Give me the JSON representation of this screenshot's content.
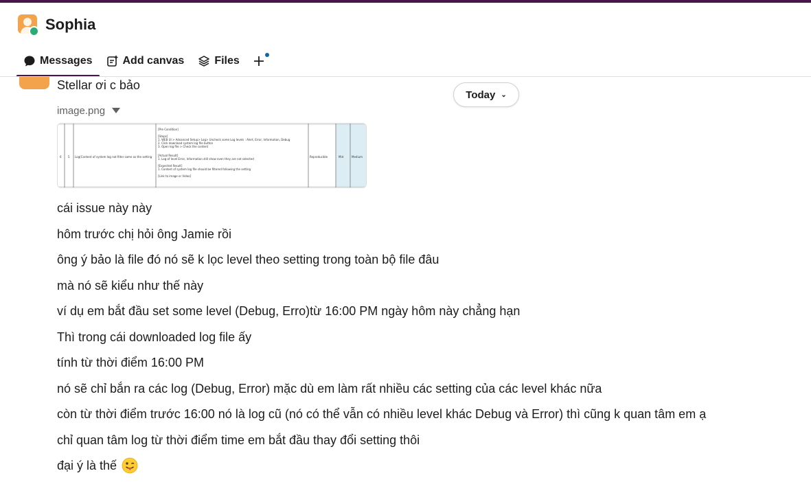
{
  "header": {
    "channel_name": "Sophia",
    "tabs": [
      {
        "label": "Messages",
        "icon": "message-bubble-icon",
        "active": true
      },
      {
        "label": "Add canvas",
        "icon": "canvas-add-icon",
        "active": false
      },
      {
        "label": "Files",
        "icon": "layers-icon",
        "active": false
      }
    ],
    "add_tab_icon": "plus-icon",
    "accent_color": "#4a154b",
    "presence_color": "#2bac76"
  },
  "date_divider": {
    "label": "Today"
  },
  "messages": {
    "first": "Stellar ơi c bảo",
    "file_name": "image.png",
    "thumbnail": {
      "col_a": "6",
      "col_b": "5",
      "title": "Log(Content of system log not filter same as the setting",
      "steps_header": "[Pre Condition]",
      "steps": "[Steps]\n1. WEB UI > Advanced Setup> Log> Uncheck some Log levels : Alert, Error, Information, Debug\n2. Click download system log file button\n3. Open log file > Check the content",
      "actual": "[Actual Result]\n1. Log of level Error, Information still show even they are not selected",
      "expected": "[Expected Result]\n1. Content of system log file should be filtered following the setting",
      "link": "[Link to image or Video]",
      "status": "Reproducible",
      "priority": "Mid",
      "extra": "Medium"
    },
    "lines": [
      "cái issue này này",
      "hôm trước chị hỏi ông Jamie rồi",
      "ông ý bảo là file đó nó sẽ k lọc level theo setting trong toàn bộ file đâu",
      "mà nó sẽ kiểu như thế này",
      "ví dụ em bắt đầu set some level (Debug, Erro)từ 16:00 PM ngày hôm này chẳng hạn",
      "Thì trong cái downloaded log file ấy",
      "tính từ thời điểm 16:00 PM",
      "nó sẽ chỉ bắn ra các log (Debug, Error) mặc dù em làm rất nhiều các setting của các level khác nữa",
      "còn từ thời điểm trước 16:00 nó là log cũ (nó có thể vẫn có nhiều level khác Debug và Error) thì cũng k quan tâm em ạ",
      "chỉ quan tâm log từ thời điểm time em bắt đầu thay đổi setting thôi",
      "đại ý là thế"
    ],
    "last_emoji": "winking-face-with-tongue-icon"
  }
}
